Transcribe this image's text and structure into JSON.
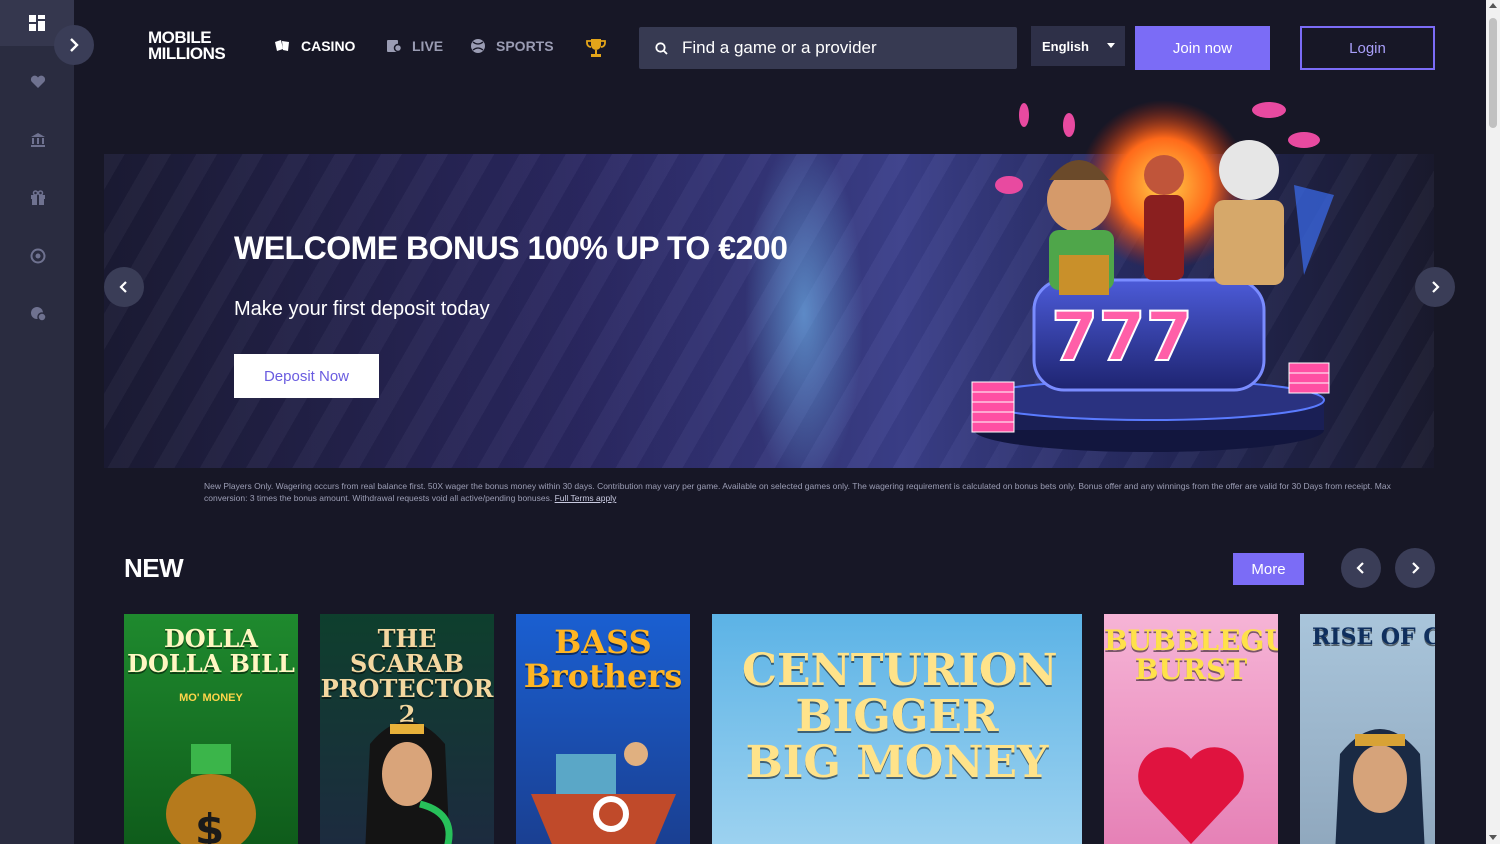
{
  "sidebar": {
    "items": [
      {
        "icon": "grid-icon"
      },
      {
        "icon": "heart-icon"
      },
      {
        "icon": "bank-icon"
      },
      {
        "icon": "gift-icon"
      },
      {
        "icon": "target-icon"
      },
      {
        "icon": "support-chat-icon"
      }
    ],
    "expand_icon": "chevron-right-icon"
  },
  "header": {
    "logo_line1": "MOBILE",
    "logo_line2": "MILLIONS",
    "nav": [
      {
        "label": "CASINO",
        "icon": "cards-icon",
        "active": true
      },
      {
        "label": "LIVE",
        "icon": "live-dealer-icon",
        "active": false
      },
      {
        "label": "SPORTS",
        "icon": "ball-icon",
        "active": false
      }
    ],
    "trophy_icon": "trophy-icon",
    "search_placeholder": "Find a game or a provider",
    "language": "English",
    "join_label": "Join now",
    "login_label": "Login"
  },
  "banner": {
    "title": "WELCOME BONUS 100% UP TO €200",
    "subtitle": "Make your first deposit today",
    "cta_label": "Deposit Now",
    "terms": "New Players Only. Wagering occurs from real balance first. 50X wager the bonus money within 30 days. Contribution may vary per game. Available on selected games only. The wagering requirement is calculated on bonus bets only. Bonus offer and any winnings from the offer are valid for 30 Days from receipt. Max conversion: 3 times the bonus amount. Withdrawal requests void all active/pending bonuses.",
    "terms_link": "Full Terms apply"
  },
  "new_section": {
    "title": "NEW",
    "more_label": "More",
    "games": [
      {
        "title": "DOLLA DOLLA BILL",
        "subtitle": "MO' MONEY"
      },
      {
        "title": "THE SCARAB PROTECTOR 2",
        "subtitle": ""
      },
      {
        "title": "BASS Brothers",
        "subtitle": ""
      },
      {
        "title": "CENTURION BIGGER BIG MONEY",
        "subtitle": ""
      },
      {
        "title": "BUBBLEGUM BURST",
        "subtitle": ""
      },
      {
        "title": "RISE OF CLEOPATRA",
        "subtitle": ""
      }
    ]
  },
  "colors": {
    "accent": "#7b6cf6",
    "sidebar": "#2a2c40",
    "background": "#171726"
  }
}
